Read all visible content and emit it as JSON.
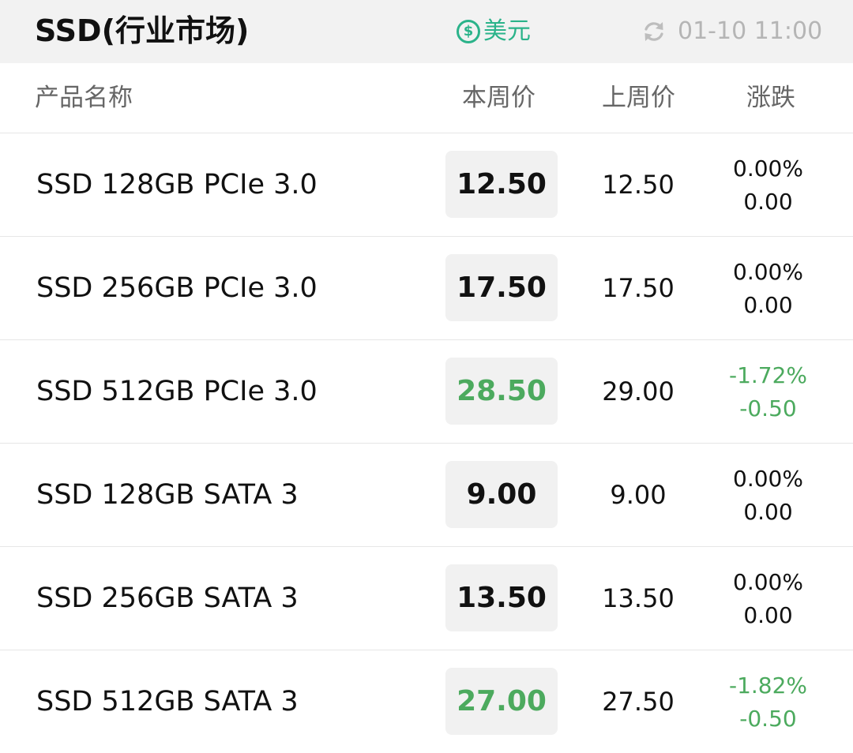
{
  "header": {
    "title": "SSD(行业市场)",
    "currency_label": "美元",
    "update_time": "01-10 11:00"
  },
  "columns": {
    "name": "产品名称",
    "this_week": "本周价",
    "last_week": "上周价",
    "change": "涨跌"
  },
  "colors": {
    "accent": "#2bb38a",
    "down": "#4caa5e"
  },
  "rows": [
    {
      "name": "SSD 128GB PCIe 3.0",
      "this_week": "12.50",
      "last_week": "12.50",
      "change_pct": "0.00%",
      "change_abs": "0.00",
      "trend": "flat"
    },
    {
      "name": "SSD 256GB PCIe 3.0",
      "this_week": "17.50",
      "last_week": "17.50",
      "change_pct": "0.00%",
      "change_abs": "0.00",
      "trend": "flat"
    },
    {
      "name": "SSD 512GB PCIe 3.0",
      "this_week": "28.50",
      "last_week": "29.00",
      "change_pct": "-1.72%",
      "change_abs": "-0.50",
      "trend": "down"
    },
    {
      "name": "SSD 128GB SATA 3",
      "this_week": "9.00",
      "last_week": "9.00",
      "change_pct": "0.00%",
      "change_abs": "0.00",
      "trend": "flat"
    },
    {
      "name": "SSD 256GB SATA 3",
      "this_week": "13.50",
      "last_week": "13.50",
      "change_pct": "0.00%",
      "change_abs": "0.00",
      "trend": "flat"
    },
    {
      "name": "SSD 512GB SATA 3",
      "this_week": "27.00",
      "last_week": "27.50",
      "change_pct": "-1.82%",
      "change_abs": "-0.50",
      "trend": "down"
    }
  ]
}
